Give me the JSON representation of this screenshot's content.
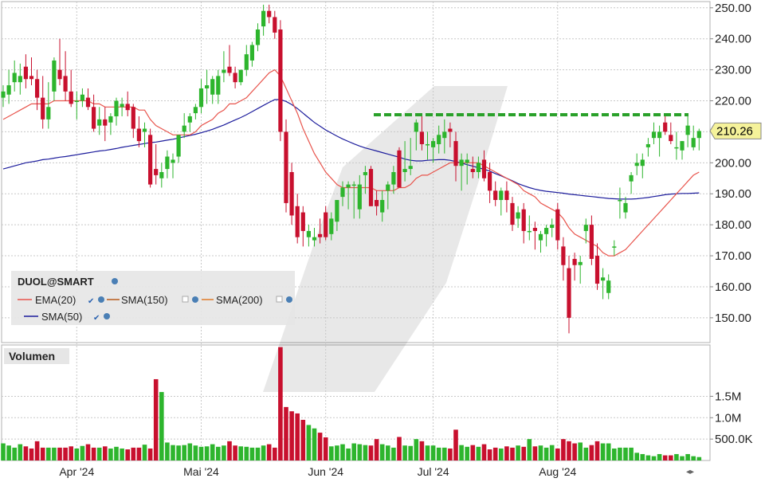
{
  "colors": {
    "up": "#2db52d",
    "down": "#c8102e",
    "ema20": "#e8544c",
    "sma50": "#1c1c9c",
    "sma150": "#b85a1a",
    "sma200": "#e07a28",
    "resistance": "#2aa12a",
    "grid": "#c8c8c8",
    "price_tag_bg": "#f5f29a"
  },
  "chart_data": {
    "type": "candlestick",
    "symbol": "DUOL@SMART",
    "last_price": 210.26,
    "last_price_label": "210.26",
    "ylim": [
      142,
      252
    ],
    "y_ticks": [
      150,
      160,
      170,
      180,
      190,
      200,
      210,
      220,
      230,
      240,
      250
    ],
    "y_tick_labels": [
      "150.00",
      "160.00",
      "170.00",
      "180.00",
      "190.00",
      "200.00",
      "210.00",
      "220.00",
      "230.00",
      "240.00",
      "250.00"
    ],
    "x_labels": [
      {
        "label": "Apr '24",
        "date": "2024-04-01"
      },
      {
        "label": "Mai '24",
        "date": "2024-05-01"
      },
      {
        "label": "Jun '24",
        "date": "2024-06-03"
      },
      {
        "label": "Jul '24",
        "date": "2024-07-01"
      },
      {
        "label": "Aug '24",
        "date": "2024-08-01"
      }
    ],
    "resistance_level": 215.5,
    "dates": [
      "2024-03-12",
      "2024-03-13",
      "2024-03-14",
      "2024-03-15",
      "2024-03-18",
      "2024-03-19",
      "2024-03-20",
      "2024-03-21",
      "2024-03-22",
      "2024-03-25",
      "2024-03-26",
      "2024-03-27",
      "2024-03-28",
      "2024-04-01",
      "2024-04-02",
      "2024-04-03",
      "2024-04-04",
      "2024-04-05",
      "2024-04-08",
      "2024-04-09",
      "2024-04-10",
      "2024-04-11",
      "2024-04-12",
      "2024-04-15",
      "2024-04-16",
      "2024-04-17",
      "2024-04-18",
      "2024-04-19",
      "2024-04-22",
      "2024-04-23",
      "2024-04-24",
      "2024-04-25",
      "2024-04-26",
      "2024-04-29",
      "2024-04-30",
      "2024-05-01",
      "2024-05-02",
      "2024-05-03",
      "2024-05-06",
      "2024-05-07",
      "2024-05-08",
      "2024-05-09",
      "2024-05-10",
      "2024-05-13",
      "2024-05-14",
      "2024-05-15",
      "2024-05-16",
      "2024-05-17",
      "2024-05-20",
      "2024-05-21",
      "2024-05-22",
      "2024-05-23",
      "2024-05-24",
      "2024-05-28",
      "2024-05-29",
      "2024-05-30",
      "2024-05-31",
      "2024-06-03",
      "2024-06-04",
      "2024-06-05",
      "2024-06-06",
      "2024-06-07",
      "2024-06-10",
      "2024-06-11",
      "2024-06-12",
      "2024-06-13",
      "2024-06-14",
      "2024-06-17",
      "2024-06-18",
      "2024-06-20",
      "2024-06-21",
      "2024-06-24",
      "2024-06-25",
      "2024-06-26",
      "2024-06-27",
      "2024-06-28",
      "2024-07-01",
      "2024-07-02",
      "2024-07-03",
      "2024-07-05",
      "2024-07-08",
      "2024-07-09",
      "2024-07-10",
      "2024-07-11",
      "2024-07-12",
      "2024-07-15",
      "2024-07-16",
      "2024-07-17",
      "2024-07-18",
      "2024-07-19",
      "2024-07-22",
      "2024-07-23",
      "2024-07-24",
      "2024-07-25",
      "2024-07-26",
      "2024-07-29",
      "2024-07-30",
      "2024-07-31",
      "2024-08-01",
      "2024-08-02",
      "2024-08-05",
      "2024-08-06",
      "2024-08-07",
      "2024-08-08",
      "2024-08-09",
      "2024-08-12",
      "2024-08-13",
      "2024-08-14",
      "2024-08-15",
      "2024-08-16",
      "2024-08-19",
      "2024-08-20",
      "2024-08-21",
      "2024-08-22",
      "2024-08-23",
      "2024-08-26",
      "2024-08-27",
      "2024-08-28",
      "2024-08-29",
      "2024-08-30",
      "2024-09-03",
      "2024-09-04",
      "2024-09-05",
      "2024-09-06"
    ],
    "open": [
      221,
      222,
      226,
      226,
      231,
      228,
      227,
      221,
      214,
      223,
      230,
      228,
      223,
      220,
      220,
      221,
      218,
      212,
      214,
      213,
      215,
      218,
      219,
      218,
      211,
      210,
      209,
      198,
      195,
      198,
      200,
      202,
      210,
      213,
      216,
      218,
      224,
      222,
      222,
      229,
      231,
      229,
      226,
      230,
      233,
      238,
      244,
      249,
      247,
      243,
      210,
      197,
      186,
      184,
      176,
      175,
      177,
      184,
      177,
      181,
      189,
      192,
      193,
      185,
      196,
      198,
      188,
      184,
      191,
      193,
      204,
      197,
      198,
      210,
      210,
      206,
      205,
      206,
      208,
      211,
      207,
      199,
      200,
      198,
      197,
      201,
      197,
      191,
      188,
      191,
      187,
      182,
      185,
      178,
      179,
      175,
      177,
      179,
      185,
      173,
      166,
      169,
      167,
      178,
      180,
      170,
      162,
      158,
      173,
      188,
      184,
      194,
      199,
      199,
      205,
      208,
      208,
      213,
      209,
      205,
      204,
      209,
      205,
      208
    ],
    "high": [
      225,
      230,
      233,
      232,
      235,
      234,
      230,
      228,
      226,
      234,
      240,
      236,
      230,
      223,
      224,
      224,
      222,
      218,
      218,
      216,
      221,
      221,
      223,
      219,
      215,
      213,
      211,
      206,
      200,
      204,
      203,
      209,
      216,
      216,
      219,
      227,
      230,
      228,
      230,
      236,
      238,
      231,
      230,
      238,
      239,
      245,
      251,
      251,
      249,
      246,
      214,
      200,
      190,
      186,
      180,
      179,
      182,
      186,
      184,
      188,
      194,
      194,
      194,
      196,
      199,
      199,
      191,
      191,
      194,
      199,
      205,
      207,
      208,
      214,
      215,
      210,
      208,
      212,
      214,
      213,
      210,
      203,
      203,
      202,
      202,
      204,
      200,
      194,
      192,
      194,
      189,
      186,
      187,
      183,
      181,
      178,
      180,
      182,
      187,
      176,
      170,
      171,
      170,
      182,
      183,
      174,
      166,
      164,
      175,
      192,
      189,
      197,
      203,
      203,
      208,
      213,
      212,
      216,
      213,
      210,
      207,
      215,
      212,
      211
    ],
    "low": [
      218,
      219,
      223,
      222,
      224,
      225,
      217,
      211,
      211,
      220,
      225,
      220,
      218,
      214,
      218,
      217,
      210,
      209,
      207,
      209,
      212,
      215,
      215,
      208,
      205,
      205,
      192,
      193,
      192,
      195,
      195,
      200,
      208,
      210,
      214,
      216,
      219,
      219,
      219,
      226,
      228,
      224,
      225,
      228,
      231,
      236,
      241,
      245,
      240,
      207,
      184,
      180,
      174,
      173,
      173,
      173,
      174,
      175,
      175,
      178,
      186,
      185,
      182,
      182,
      190,
      186,
      183,
      181,
      185,
      190,
      192,
      194,
      196,
      204,
      204,
      201,
      200,
      203,
      203,
      205,
      194,
      191,
      193,
      195,
      195,
      194,
      187,
      186,
      183,
      184,
      178,
      179,
      174,
      175,
      172,
      171,
      173,
      176,
      172,
      162,
      145,
      162,
      161,
      174,
      167,
      159,
      156,
      156,
      170,
      182,
      182,
      190,
      196,
      195,
      202,
      206,
      202,
      209,
      206,
      201,
      201,
      205,
      204,
      204
    ],
    "close": [
      223,
      225,
      229,
      228,
      227,
      227,
      221,
      214,
      218,
      233,
      227,
      223,
      219,
      220,
      222,
      218,
      211,
      214,
      212,
      215,
      220,
      219,
      217,
      211,
      207,
      211,
      193,
      196,
      197,
      202,
      201,
      209,
      212,
      215,
      218,
      224,
      225,
      227,
      228,
      230,
      229,
      226,
      230,
      235,
      238,
      243,
      249,
      247,
      242,
      210,
      187,
      183,
      176,
      178,
      178,
      176,
      176,
      176,
      182,
      188,
      192,
      193,
      193,
      193,
      197,
      186,
      186,
      188,
      193,
      197,
      192,
      198,
      199,
      213,
      206,
      206,
      207,
      209,
      210,
      210,
      199,
      201,
      201,
      197,
      200,
      195,
      191,
      188,
      191,
      188,
      180,
      184,
      178,
      178,
      178,
      177,
      179,
      180,
      175,
      167,
      150,
      167,
      168,
      180,
      169,
      161,
      163,
      162,
      173,
      188,
      187,
      196,
      200,
      201,
      206,
      210,
      210,
      210,
      207,
      205,
      207,
      212,
      208,
      210.26
    ],
    "volume": [
      0.4,
      0.35,
      0.3,
      0.38,
      0.33,
      0.28,
      0.45,
      0.3,
      0.3,
      0.3,
      0.3,
      0.3,
      0.33,
      0.28,
      0.34,
      0.38,
      0.3,
      0.3,
      0.33,
      0.28,
      0.32,
      0.28,
      0.26,
      0.3,
      0.3,
      0.37,
      0.28,
      1.9,
      1.6,
      0.42,
      0.36,
      0.35,
      0.36,
      0.4,
      0.35,
      0.32,
      0.33,
      0.38,
      0.32,
      0.35,
      0.45,
      0.35,
      0.33,
      0.32,
      0.3,
      0.3,
      0.35,
      0.38,
      0.3,
      2.65,
      1.25,
      1.15,
      1.1,
      0.95,
      0.83,
      0.75,
      0.65,
      0.54,
      0.33,
      0.35,
      0.38,
      0.28,
      0.4,
      0.38,
      0.36,
      0.35,
      0.5,
      0.38,
      0.35,
      0.3,
      0.55,
      0.35,
      0.34,
      0.5,
      0.45,
      0.35,
      0.35,
      0.3,
      0.3,
      0.28,
      0.72,
      0.36,
      0.32,
      0.36,
      0.32,
      0.38,
      0.26,
      0.3,
      0.28,
      0.33,
      0.3,
      0.35,
      0.32,
      0.5,
      0.33,
      0.35,
      0.3,
      0.36,
      0.28,
      0.5,
      0.45,
      0.4,
      0.42,
      0.3,
      0.36,
      0.45,
      0.4,
      0.4,
      0.28,
      0.3,
      0.3,
      0.3,
      0.18,
      0.15,
      0.12,
      0.1,
      0.15,
      0.12,
      0.12,
      0.15,
      0.1,
      0.15,
      0.1,
      0.08
    ],
    "indicators": {
      "ema20": [
        214,
        215,
        216,
        217,
        218,
        219,
        219,
        219,
        219,
        220,
        220,
        220,
        220,
        220,
        220,
        220,
        219,
        219,
        218,
        218,
        218,
        218,
        218,
        218,
        217,
        217,
        214,
        212,
        211,
        210,
        209,
        209,
        209,
        209,
        210,
        212,
        213,
        214,
        216,
        217,
        219,
        219,
        220,
        221,
        223,
        225,
        227,
        229,
        230,
        228,
        224,
        220,
        216,
        211,
        207,
        203,
        200,
        197,
        195,
        193,
        192,
        192,
        192,
        192,
        192,
        192,
        191,
        191,
        191,
        191,
        192,
        192,
        193,
        195,
        196,
        196,
        197,
        198,
        199,
        200,
        200,
        200,
        200,
        200,
        200,
        199,
        198,
        197,
        196,
        195,
        194,
        193,
        191,
        190,
        189,
        187,
        186,
        185,
        184,
        182,
        179,
        177,
        176,
        175,
        174,
        173,
        171,
        170,
        170,
        171,
        172,
        174,
        176,
        178,
        180,
        182,
        184,
        186,
        188,
        190,
        192,
        194,
        196,
        197
      ],
      "sma50": [
        198,
        198.5,
        199,
        199.5,
        200,
        200.3,
        200.6,
        201,
        201.2,
        201.5,
        201.8,
        202,
        202.3,
        202.6,
        202.9,
        203.2,
        203.5,
        203.8,
        204,
        204.3,
        204.6,
        205,
        205.3,
        205.6,
        205.9,
        206.2,
        206.5,
        206.7,
        207,
        207.3,
        207.6,
        208,
        208.4,
        208.8,
        209.2,
        209.7,
        210.2,
        210.8,
        211.5,
        212.2,
        213,
        213.8,
        214.6,
        215.5,
        216.5,
        217.5,
        218.5,
        219.5,
        220.4,
        220.4,
        219.8,
        218.8,
        217.5,
        216,
        214.5,
        213,
        211.8,
        210.6,
        209.6,
        208.6,
        207.7,
        206.9,
        206.1,
        205.4,
        204.8,
        204.3,
        203.8,
        203.3,
        202.8,
        202.3,
        201.8,
        201.2,
        200.8,
        200.6,
        200.6,
        200.8,
        200.9,
        201,
        201,
        200.8,
        200.4,
        199.9,
        199.4,
        198.9,
        198.4,
        197.9,
        197.3,
        196.5,
        195.8,
        195,
        194.2,
        193.3,
        192.6,
        192,
        191.5,
        191.1,
        190.8,
        190.6,
        190.4,
        190.2,
        189.9,
        189.7,
        189.5,
        189.3,
        189.1,
        188.9,
        188.7,
        188.5,
        188.4,
        188.3,
        188.3,
        188.3,
        188.4,
        188.6,
        188.8,
        189.1,
        189.4,
        189.7,
        189.9,
        190,
        190.1,
        190.1,
        190.2,
        190.3
      ]
    }
  },
  "legend": {
    "symbol": "DUOL@SMART",
    "items": [
      {
        "label": "EMA(20)",
        "color": "#e8544c"
      },
      {
        "label": "SMA(150)",
        "color": "#b85a1a"
      },
      {
        "label": "SMA(200)",
        "color": "#e07a28"
      },
      {
        "label": "SMA(50)",
        "color": "#1c1c9c"
      }
    ]
  },
  "volume_panel": {
    "title": "Volumen",
    "y_ticks": [
      0.5,
      1.0,
      1.5
    ],
    "y_tick_labels": [
      "500.0K",
      "1.0M",
      "1.5M"
    ],
    "ylim": [
      0,
      2.7
    ]
  }
}
